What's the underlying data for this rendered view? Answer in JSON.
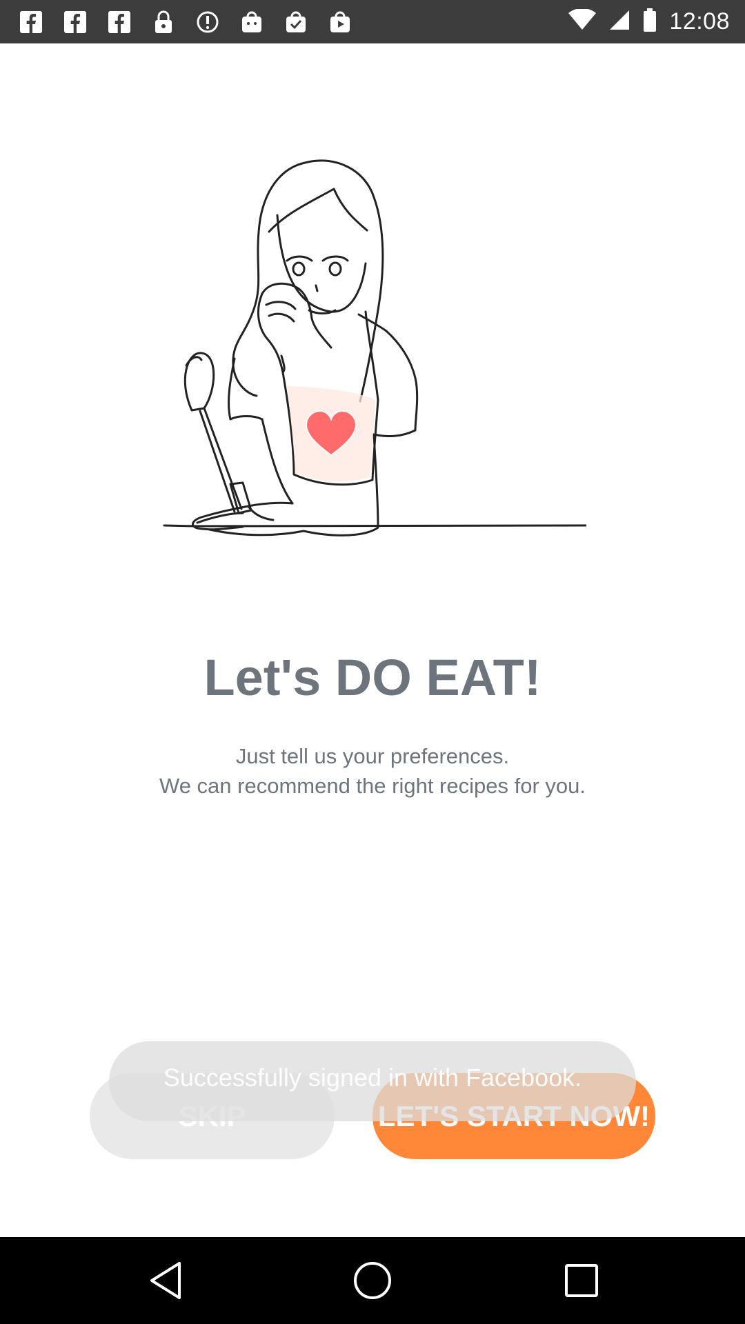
{
  "status_bar": {
    "time": "12:08",
    "notification_icons": [
      "facebook-icon",
      "facebook-icon",
      "facebook-icon",
      "lock-icon",
      "info-icon",
      "android-bag-icon",
      "checked-bag-icon",
      "play-bag-icon"
    ],
    "system_icons": [
      "wifi-icon",
      "signal-icon",
      "battery-icon"
    ]
  },
  "main": {
    "title": "Let's DO EAT!",
    "subtitle_line1": "Just tell us your preferences.",
    "subtitle_line2": "We can recommend the right recipes for you."
  },
  "toast": {
    "message": "Successfully signed in with Facebook."
  },
  "buttons": {
    "skip_label": "SKIP",
    "start_label": "LET'S START NOW!"
  },
  "colors": {
    "accent": "#ff8737",
    "text": "#6d747c",
    "skip_bg": "#e9e9e9",
    "heart": "#ff6b6b"
  },
  "nav_bar": {
    "icons": [
      "back-icon",
      "home-icon",
      "recents-icon"
    ]
  }
}
